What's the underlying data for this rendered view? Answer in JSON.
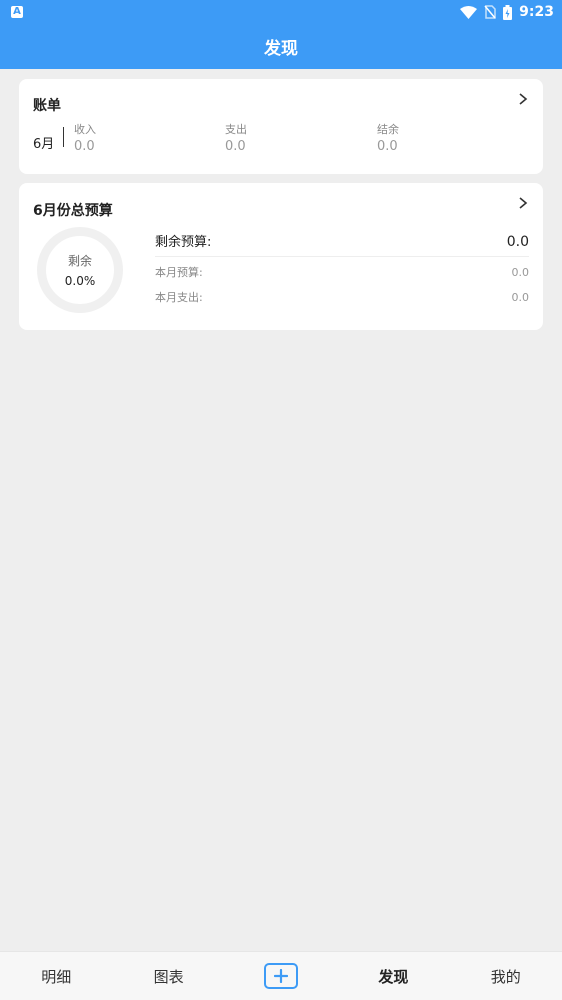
{
  "status_bar": {
    "time": "9:23",
    "left_icon_letter": "A",
    "icons": [
      "a-notification-icon",
      "wifi-icon",
      "no-sim-icon",
      "battery-icon"
    ]
  },
  "app_bar": {
    "title": "发现"
  },
  "bill_card": {
    "title": "账单",
    "month": "6月",
    "income_label": "收入",
    "income_value": "0.0",
    "expense_label": "支出",
    "expense_value": "0.0",
    "balance_label": "结余",
    "balance_value": "0.0"
  },
  "budget_card": {
    "title": "6月份总预算",
    "ring_label": "剩余",
    "ring_percent": "0.0%",
    "remaining_label": "剩余预算:",
    "remaining_value": "0.0",
    "month_budget_label": "本月预算:",
    "month_budget_value": "0.0",
    "month_expense_label": "本月支出:",
    "month_expense_value": "0.0"
  },
  "bottom_nav": {
    "items": [
      {
        "label": "明细",
        "active": false
      },
      {
        "label": "图表",
        "active": false
      },
      {
        "label": "",
        "icon": "add-icon",
        "active": false
      },
      {
        "label": "发现",
        "active": true
      },
      {
        "label": "我的",
        "active": false
      }
    ]
  },
  "colors": {
    "primary": "#3d9bf6",
    "background": "#eeeeee",
    "card": "#ffffff",
    "ring_track": "#f0f0f0"
  }
}
